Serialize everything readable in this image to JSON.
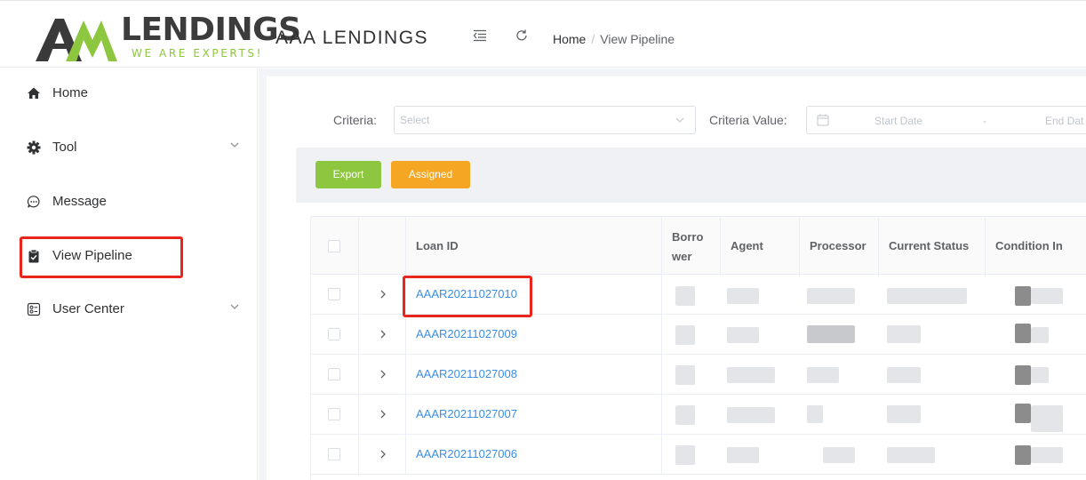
{
  "brand": {
    "logo_text": "LENDINGS",
    "logo_tagline": "WE ARE EXPERTS!",
    "app_title": "AAA LENDINGS",
    "accent_green": "#8dc63f",
    "logo_dark": "#3c3c3c"
  },
  "header": {
    "menu_toggle_icon": "menu-fold-icon",
    "refresh_icon": "refresh-icon",
    "breadcrumb": {
      "home": "Home",
      "separator": "/",
      "current": "View Pipeline"
    }
  },
  "sidebar": {
    "items": [
      {
        "label": "Home",
        "icon": "home-icon"
      },
      {
        "label": "Tool",
        "icon": "gear-icon",
        "expandable": true
      },
      {
        "label": "Message",
        "icon": "message-icon"
      },
      {
        "label": "View Pipeline",
        "icon": "clipboard-icon",
        "active": true
      },
      {
        "label": "User Center",
        "icon": "user-center-icon",
        "expandable": true
      }
    ]
  },
  "filters": {
    "criteria_label": "Criteria:",
    "criteria_placeholder": "Select",
    "criteria_value_label": "Criteria Value:",
    "start_date_placeholder": "Start Date",
    "range_separator": "-",
    "end_date_placeholder": "End Dat"
  },
  "toolbar": {
    "export_label": "Export",
    "assigned_label": "Assigned",
    "export_color": "#8dc63f",
    "assigned_color": "#f5a623"
  },
  "table": {
    "columns": [
      "",
      "",
      "Loan ID",
      "Borro wer",
      "Agent",
      "Processor",
      "Current Status",
      "Condition In"
    ],
    "borrower_header_line1": "Borro",
    "borrower_header_line2": "wer",
    "rows": [
      {
        "loan_id": "AAAR20211027010"
      },
      {
        "loan_id": "AAAR20211027009"
      },
      {
        "loan_id": "AAAR20211027008"
      },
      {
        "loan_id": "AAAR20211027007"
      },
      {
        "loan_id": "AAAR20211027006"
      }
    ]
  },
  "annotations": {
    "highlight_color": "#e8261e"
  }
}
